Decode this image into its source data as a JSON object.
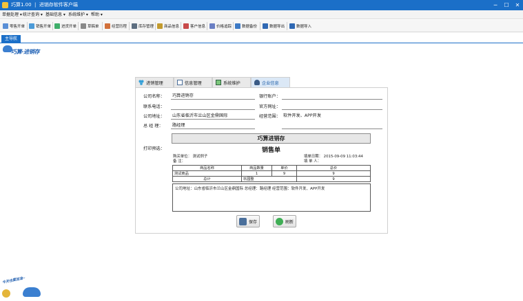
{
  "window": {
    "title": "巧算1.00  |  进销存软件客户端",
    "minimize": "─",
    "maximize": "☐",
    "close": "✕"
  },
  "menu": [
    "单据处理 ▾",
    "统计查询 ▾",
    "基础信息 ▾",
    "系统维护 ▾",
    "帮助 ▾"
  ],
  "toolbar": [
    "零售开单",
    "销售开单",
    "进货开单",
    "草稿单",
    "经营历程",
    "库存管理",
    "商品信息",
    "客户信息",
    "价格追踪",
    "数据备份",
    "数据导出",
    "数据导入"
  ],
  "nav": {
    "main_tab": "主导航"
  },
  "brand": {
    "name": "巧算·进销存"
  },
  "tabs": [
    "进销管理",
    "信息管理",
    "系统维护",
    "企业信息"
  ],
  "form": {
    "company_name_label": "公司名称：",
    "company_name": "巧算进销存",
    "phone_label": "联系电话：",
    "phone": "",
    "address_label": "公司地址：",
    "address": "山东省临沂市兰山区金鼎国际",
    "manager_label": "总 经 理：",
    "manager": "路经理",
    "bank_label": "银行账户：",
    "bank": "",
    "website_label": "官方网址：",
    "website": "",
    "scope_label": "经营范围：",
    "scope": "软件开发、APP开发",
    "print_preview_label": "打印预选："
  },
  "preview": {
    "title": "巧算进销存",
    "doc_title": "销售单",
    "buyer": "购买单位：  测试例子",
    "remark": "备      注：",
    "date": "填单日期：  2015-09-09 11:03:44",
    "maker": "填  单  人：",
    "table": {
      "headers": [
        "商品名称",
        "商品数量",
        "单价",
        "总价"
      ],
      "rows": [
        [
          "测试商品",
          "1",
          "9",
          "9"
        ]
      ],
      "total_label": "总计",
      "total_cn": "玖圆整",
      "total_value": "9"
    },
    "memo": "公司地址：山东省临沂市兰山区金鼎国际    总经理：路经理    经营范围：软件开发、APP开发"
  },
  "buttons": {
    "save": "保存",
    "refresh": "刷新"
  },
  "mascot": {
    "text": "今天也要加油~"
  }
}
